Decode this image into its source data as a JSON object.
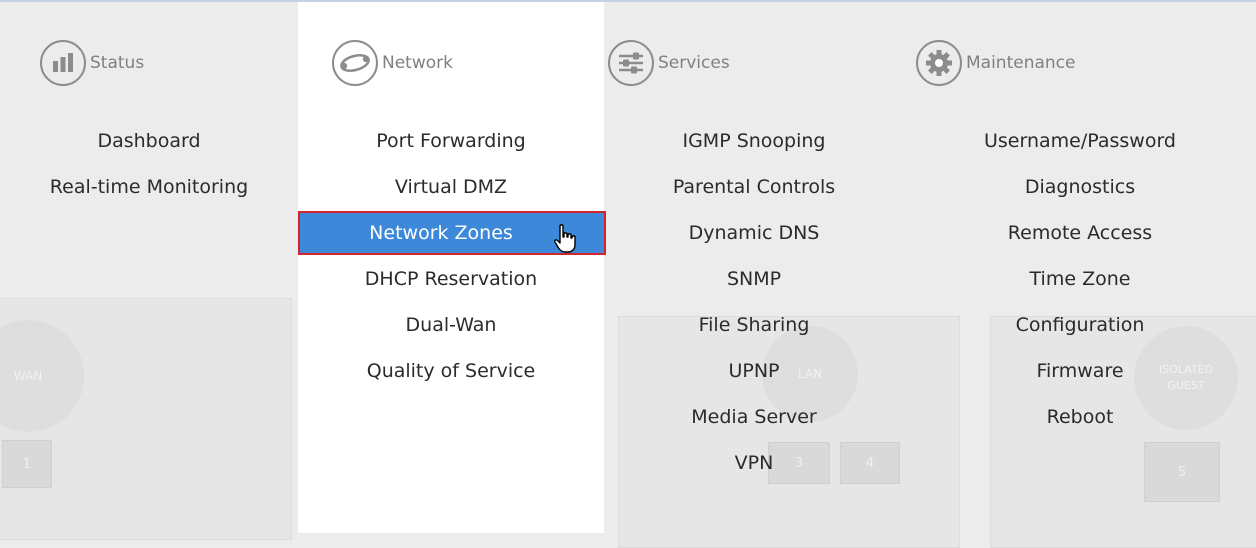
{
  "nav": {
    "columns": [
      {
        "id": "status",
        "header": "Status",
        "icon": "bar-chart-icon",
        "items": [
          "Dashboard",
          "Real-time Monitoring"
        ]
      },
      {
        "id": "network",
        "header": "Network",
        "icon": "network-orbit-icon",
        "items": [
          "Port Forwarding",
          "Virtual DMZ",
          "Network Zones",
          "DHCP Reservation",
          "Dual-Wan",
          "Quality of Service"
        ],
        "selected_item": "Network Zones"
      },
      {
        "id": "services",
        "header": "Services",
        "icon": "sliders-icon",
        "items": [
          "IGMP Snooping",
          "Parental Controls",
          "Dynamic DNS",
          "SNMP",
          "File Sharing",
          "UPNP",
          "Media Server",
          "VPN"
        ]
      },
      {
        "id": "maintenance",
        "header": "Maintenance",
        "icon": "gear-icon",
        "items": [
          "Username/Password",
          "Diagnostics",
          "Remote Access",
          "Time Zone",
          "Configuration",
          "Firmware",
          "Reboot"
        ]
      }
    ]
  },
  "background": {
    "wan_label": "WAN",
    "lan_label": "LAN",
    "isolated_label": "ISOLATED GUEST",
    "ports": [
      "1",
      "3",
      "4",
      "5"
    ]
  },
  "colors": {
    "selected_bg": "#3d88d9",
    "selected_border": "#d3252b",
    "active_column_bg": "#ffffff",
    "page_bg": "#ececec"
  }
}
